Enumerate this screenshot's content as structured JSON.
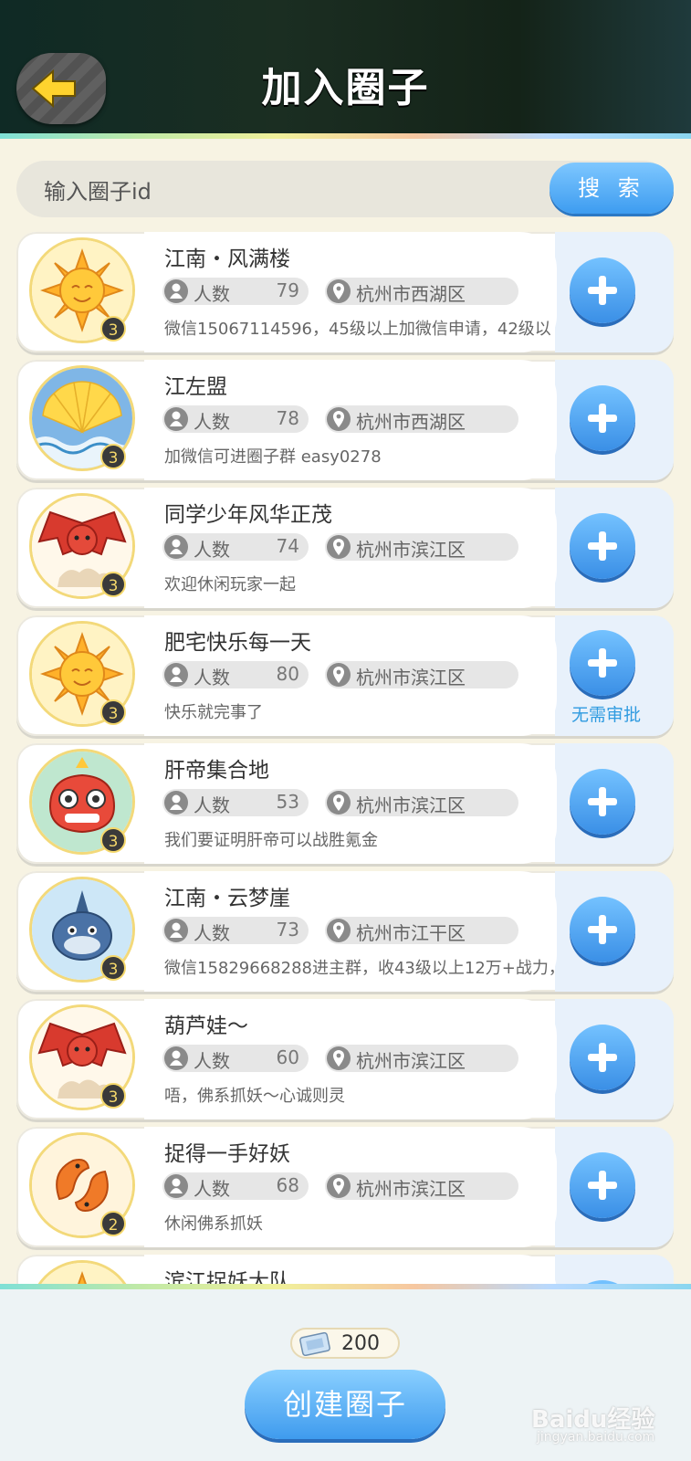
{
  "header": {
    "title": "加入圈子",
    "back_icon": "back-arrow-icon"
  },
  "search": {
    "placeholder": "输入圈子id",
    "button_label": "搜 索"
  },
  "circles": [
    {
      "name": "江南・风满楼",
      "level": "3",
      "members_label": "人数",
      "members": "79",
      "location": "杭州市西湖区",
      "desc": "微信15067114596，45级以上加微信申请，42级以",
      "avatar": "sun",
      "badge": ""
    },
    {
      "name": "江左盟",
      "level": "3",
      "members_label": "人数",
      "members": "78",
      "location": "杭州市西湖区",
      "desc": "加微信可进圈子群 easy0278",
      "avatar": "fan",
      "badge": ""
    },
    {
      "name": "同学少年风华正茂",
      "level": "3",
      "members_label": "人数",
      "members": "74",
      "location": "杭州市滨江区",
      "desc": "欢迎休闲玩家一起",
      "avatar": "bat",
      "badge": ""
    },
    {
      "name": "肥宅快乐每一天",
      "level": "3",
      "members_label": "人数",
      "members": "80",
      "location": "杭州市滨江区",
      "desc": "快乐就完事了",
      "avatar": "sun",
      "badge": "无需审批"
    },
    {
      "name": "肝帝集合地",
      "level": "3",
      "members_label": "人数",
      "members": "53",
      "location": "杭州市滨江区",
      "desc": "我们要证明肝帝可以战胜氪金",
      "avatar": "lion",
      "badge": ""
    },
    {
      "name": "江南・云梦崖",
      "level": "3",
      "members_label": "人数",
      "members": "73",
      "location": "杭州市江干区",
      "desc": "微信15829668288进主群，收43级以上12万+战力，",
      "avatar": "fish",
      "badge": ""
    },
    {
      "name": "葫芦娃～",
      "level": "3",
      "members_label": "人数",
      "members": "60",
      "location": "杭州市滨江区",
      "desc": "唔，佛系抓妖～心诚则灵",
      "avatar": "bat",
      "badge": ""
    },
    {
      "name": "捉得一手好妖",
      "level": "2",
      "members_label": "人数",
      "members": "68",
      "location": "杭州市滨江区",
      "desc": "休闲佛系抓妖",
      "avatar": "koi",
      "badge": ""
    },
    {
      "name": "滨江捉妖大队",
      "level": "",
      "members_label": "",
      "members": "",
      "location": "",
      "desc": "",
      "avatar": "sun",
      "badge": ""
    }
  ],
  "footer": {
    "coin_amount": "200",
    "create_label": "创建圈子",
    "coin_icon": "ticket-icon"
  },
  "watermark": {
    "brand": "Baidu经验",
    "url": "jingyan.baidu.com"
  },
  "colors": {
    "accent": "#3d9cf0",
    "no_review": "#2f9be0",
    "header_bg": "#142318"
  }
}
